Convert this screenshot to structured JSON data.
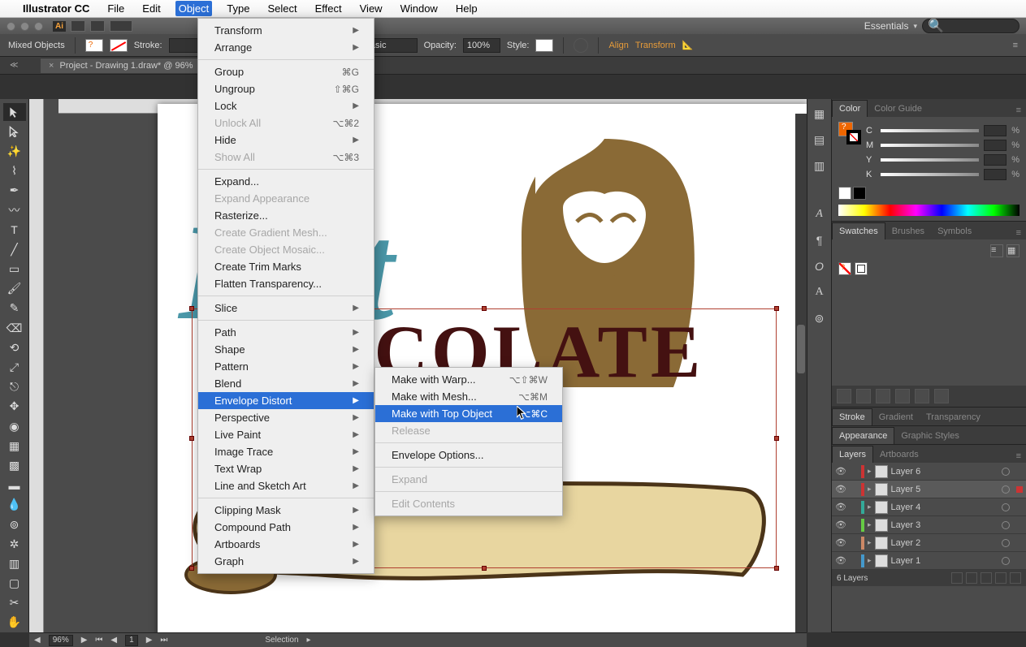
{
  "mac_menu": {
    "app": "Illustrator CC",
    "items": [
      "File",
      "Edit",
      "Object",
      "Type",
      "Select",
      "Effect",
      "View",
      "Window",
      "Help"
    ],
    "open_index": 2
  },
  "workspace_switcher": "Essentials",
  "options_bar": {
    "selection_label": "Mixed Objects",
    "stroke_label": "Stroke:",
    "style_dropdown": "Basic",
    "opacity_label": "Opacity:",
    "opacity_value": "100%",
    "style_label2": "Style:",
    "align_label": "Align",
    "transform_label": "Transform"
  },
  "doc_tab": "Project - Drawing 1.draw* @ 96% ",
  "artwork": {
    "hot_text": "Hot",
    "choc_text": "CHOCOLATE"
  },
  "statusbar": {
    "zoom": "96%",
    "artboard_nav": "1",
    "tool": "Selection"
  },
  "panels": {
    "color": {
      "tab1": "Color",
      "tab2": "Color Guide",
      "channels": [
        "C",
        "M",
        "Y",
        "K"
      ],
      "pct": "%"
    },
    "swatches": {
      "tab1": "Swatches",
      "tab2": "Brushes",
      "tab3": "Symbols"
    },
    "stroke_tabs": {
      "t1": "Stroke",
      "t2": "Gradient",
      "t3": "Transparency"
    },
    "appearance_tabs": {
      "t1": "Appearance",
      "t2": "Graphic Styles"
    },
    "layers_tabs": {
      "t1": "Layers",
      "t2": "Artboards"
    },
    "layers": [
      {
        "name": "Layer 6",
        "color": "#c33"
      },
      {
        "name": "Layer 5",
        "color": "#c33"
      },
      {
        "name": "Layer 4",
        "color": "#3a9"
      },
      {
        "name": "Layer 3",
        "color": "#6c4"
      },
      {
        "name": "Layer 2",
        "color": "#c86"
      },
      {
        "name": "Layer 1",
        "color": "#49c"
      }
    ],
    "layers_footer": "6 Layers"
  },
  "object_menu": [
    {
      "label": "Transform",
      "sub": true
    },
    {
      "label": "Arrange",
      "sub": true
    },
    {
      "sep": true
    },
    {
      "label": "Group",
      "sc": "⌘G"
    },
    {
      "label": "Ungroup",
      "sc": "⇧⌘G"
    },
    {
      "label": "Lock",
      "sub": true
    },
    {
      "label": "Unlock All",
      "sc": "⌥⌘2",
      "disabled": true
    },
    {
      "label": "Hide",
      "sub": true
    },
    {
      "label": "Show All",
      "sc": "⌥⌘3",
      "disabled": true
    },
    {
      "sep": true
    },
    {
      "label": "Expand..."
    },
    {
      "label": "Expand Appearance",
      "disabled": true
    },
    {
      "label": "Rasterize..."
    },
    {
      "label": "Create Gradient Mesh...",
      "disabled": true
    },
    {
      "label": "Create Object Mosaic...",
      "disabled": true
    },
    {
      "label": "Create Trim Marks"
    },
    {
      "label": "Flatten Transparency..."
    },
    {
      "sep": true
    },
    {
      "label": "Slice",
      "sub": true
    },
    {
      "sep": true
    },
    {
      "label": "Path",
      "sub": true
    },
    {
      "label": "Shape",
      "sub": true
    },
    {
      "label": "Pattern",
      "sub": true
    },
    {
      "label": "Blend",
      "sub": true
    },
    {
      "label": "Envelope Distort",
      "sub": true,
      "highlight": true
    },
    {
      "label": "Perspective",
      "sub": true
    },
    {
      "label": "Live Paint",
      "sub": true
    },
    {
      "label": "Image Trace",
      "sub": true
    },
    {
      "label": "Text Wrap",
      "sub": true
    },
    {
      "label": "Line and Sketch Art",
      "sub": true
    },
    {
      "sep": true
    },
    {
      "label": "Clipping Mask",
      "sub": true
    },
    {
      "label": "Compound Path",
      "sub": true
    },
    {
      "label": "Artboards",
      "sub": true
    },
    {
      "label": "Graph",
      "sub": true
    }
  ],
  "envelope_submenu": [
    {
      "label": "Make with Warp...",
      "sc": "⌥⇧⌘W"
    },
    {
      "label": "Make with Mesh...",
      "sc": "⌥⌘M"
    },
    {
      "label": "Make with Top Object",
      "sc": "⌥⌘C",
      "highlight": true
    },
    {
      "label": "Release",
      "disabled": true
    },
    {
      "sep": true
    },
    {
      "label": "Envelope Options..."
    },
    {
      "sep": true
    },
    {
      "label": "Expand",
      "disabled": true
    },
    {
      "sep": true
    },
    {
      "label": "Edit Contents",
      "disabled": true
    }
  ]
}
